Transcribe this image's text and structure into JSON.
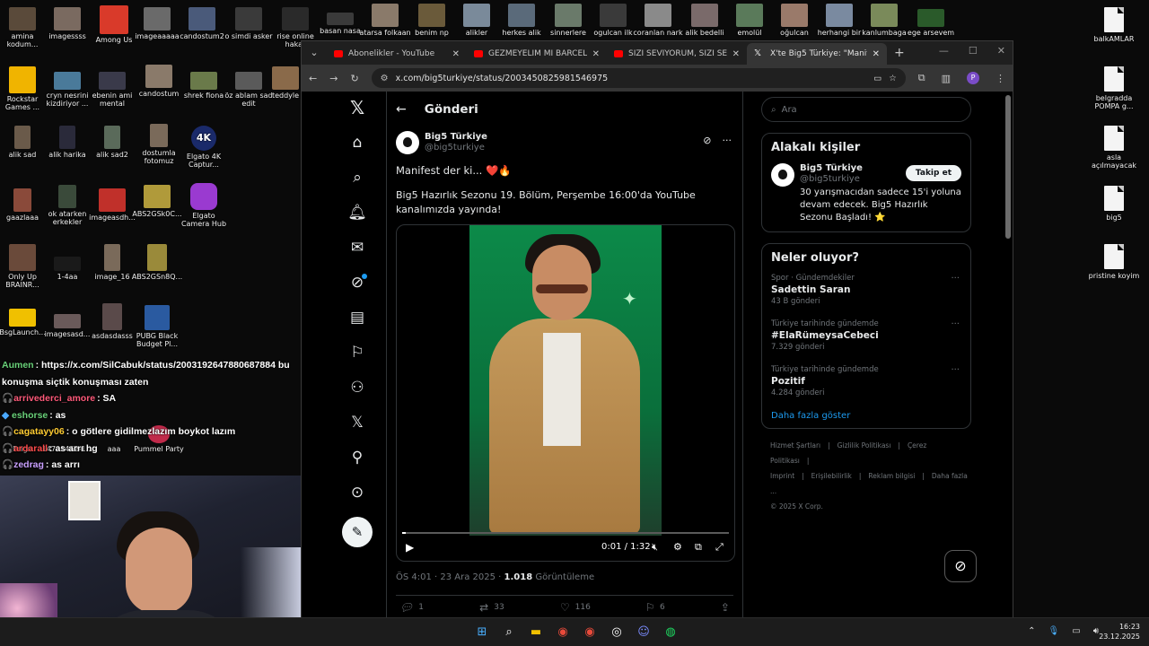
{
  "desktop": {
    "icons": [
      {
        "label": "amina kodum...",
        "color": "#5a4a3a"
      },
      {
        "label": "imagessss",
        "color": "#7a6a60"
      },
      {
        "label": "Among Us",
        "color": "#d93a2a"
      },
      {
        "label": "imageaaaaa",
        "color": "#6a6a6a"
      },
      {
        "label": "candostum2",
        "color": "#4a5a7a"
      },
      {
        "label": "o simdi asker",
        "color": "#3a3a3a"
      },
      {
        "label": "rise online hakar",
        "color": "#2a2a2a"
      },
      {
        "label": "basan nasa",
        "color": "#3a3a3a"
      },
      {
        "label": "atarsa folkaan",
        "color": "#8a7a6a"
      },
      {
        "label": "benim np",
        "color": "#6a5a3a"
      },
      {
        "label": "alikler",
        "color": "#7a8a9a"
      },
      {
        "label": "herkes alik",
        "color": "#5a6a7a"
      },
      {
        "label": "sinnerlere",
        "color": "#6a7a6a"
      },
      {
        "label": "ogulcan ilk",
        "color": "#3a3a3a"
      },
      {
        "label": "coranlan nark",
        "color": "#8a8a8a"
      },
      {
        "label": "alik bedelli",
        "color": "#7a6a6a"
      },
      {
        "label": "emolül",
        "color": "#5a7a5a"
      },
      {
        "label": "oğulcan",
        "color": "#9a7a6a"
      },
      {
        "label": "herhangi bir",
        "color": "#7a8aa0"
      },
      {
        "label": "kanlumbaga",
        "color": "#7a8a5a"
      },
      {
        "label": "ege arsevem",
        "color": "#2a5a2a"
      },
      {
        "label": "Rockstar Games ...",
        "color": "#f0b400"
      },
      {
        "label": "cryn nesrini kizdiriyor ...",
        "color": "#4a7a9a"
      },
      {
        "label": "ebenin ami mental",
        "color": "#3a3a4a"
      },
      {
        "label": "candostum",
        "color": "#8a7a6a"
      },
      {
        "label": "shrek fiona",
        "color": "#6a7a4a"
      },
      {
        "label": "öz ablam sad edit",
        "color": "#5a5a5a"
      },
      {
        "label": "teddyle",
        "color": "#8a6a4a"
      },
      {
        "label": "alik sad",
        "color": "#6a5a4a"
      },
      {
        "label": "alik harika",
        "color": "#2a2a3a"
      },
      {
        "label": "alik sad2",
        "color": "#5a6a5a"
      },
      {
        "label": "dostumla fotomuz",
        "color": "#7a6a5a"
      },
      {
        "label": "Elgato 4K Captur...",
        "color": "#1a2a6a"
      },
      {
        "label": "gaazlaaa",
        "color": "#8a4a3a"
      },
      {
        "label": "ok atarken erkekler",
        "color": "#3a4a3a"
      },
      {
        "label": "imageasdh...",
        "color": "#c0302a"
      },
      {
        "label": "ABS2GSk0C...",
        "color": "#b09a3a"
      },
      {
        "label": "Elgato Camera Hub",
        "color": "#9a3ad0"
      },
      {
        "label": "Only Up BRAINR...",
        "color": "#6a4a3a"
      },
      {
        "label": "1-4aa",
        "color": "#1a1a1a"
      },
      {
        "label": "image_16",
        "color": "#7a6a5a"
      },
      {
        "label": "ABS2GSn8Q...",
        "color": "#9a8a3a"
      },
      {
        "label": "BsgLaunch...",
        "color": "#f0c000"
      },
      {
        "label": "imagesasd...",
        "color": "#6a5a5a"
      },
      {
        "label": "asdasdasss",
        "color": "#5a4a4a"
      },
      {
        "label": "PUBG Black Budget Pl...",
        "color": "#2a5aa0"
      },
      {
        "label": "balkAMLAR",
        "color": "#f4f4f4"
      },
      {
        "label": "belgradda POMPA g...",
        "color": "#f4f4f4"
      },
      {
        "label": "asla açılmayacak",
        "color": "#f4f4f4"
      },
      {
        "label": "big5",
        "color": "#f4f4f4"
      },
      {
        "label": "pristine koyim",
        "color": "#f4f4f4"
      },
      {
        "label": "Feign",
        "color": "#5a5a6a"
      },
      {
        "label": "14701462-1...",
        "color": "#4a4a4a"
      },
      {
        "label": "aaa",
        "color": "#4a4a4a"
      },
      {
        "label": "Pummel Party",
        "color": "#c02a4a"
      }
    ]
  },
  "chat": [
    {
      "user": "Aumen",
      "color": "#6ad27a",
      "msg": ": https://x.com/SilCabuk/status/2003192647880687884 bu konuşma siçtik konuşması zaten"
    },
    {
      "user": "arrivederci_amore",
      "color": "#ff5a7a",
      "msg": ": SA"
    },
    {
      "user": "eshorse",
      "color": "#6ad27a",
      "msg": ": as"
    },
    {
      "user": "cagatayy06",
      "color": "#ffcc33",
      "msg": ": o götlere gidilmezlazım boykot lazım"
    },
    {
      "user": "ardarall",
      "color": "#ff4a4a",
      "msg": ": as arrı hg"
    },
    {
      "user": "zedrag",
      "color": "#c9a0ff",
      "msg": ": as arrı"
    }
  ],
  "browser": {
    "tabs": [
      {
        "title": "Abonelikler - YouTube",
        "icon": "youtube-icon",
        "active": false
      },
      {
        "title": "GEZMEYELİM Mİ BARCELONA",
        "icon": "youtube-icon",
        "active": false
      },
      {
        "title": "SİZİ SEVİYORUM, SİZİ SEVİYOR",
        "icon": "youtube-icon",
        "active": false
      },
      {
        "title": "X'te Big5 Türkiye: \"Manifest de",
        "icon": "x-icon",
        "active": true
      }
    ],
    "url": "x.com/big5turkiye/status/2003450825981546975",
    "profile_initial": "P"
  },
  "x": {
    "header_title": "Gönderi",
    "post": {
      "author": "Big5 Türkiye",
      "handle": "@big5turkiye",
      "text1": "Manifest der ki... ❤️🔥",
      "text2": "Big5 Hazırlık Sezonu 19. Bölüm, Perşembe 16:00'da YouTube kanalımızda yayında!",
      "video_time": "0:01 / 1:32",
      "video_progress": 0.01,
      "time": "ÖS 4:01 · 23 Ara 2025 · ",
      "views_count": "1.018",
      "views_label": " Görüntüleme",
      "replies": "1",
      "reposts": "33",
      "likes": "116",
      "bookmarks": "6"
    },
    "search_placeholder": "Ara",
    "related": {
      "title": "Alakalı kişiler",
      "name": "Big5 Türkiye",
      "handle": "@big5turkiye",
      "follow_label": "Takip et",
      "bio": "30 yarışmacıdan sadece 15'i yoluna devam edecek. Big5 Hazırlık Sezonu Başladı! ⭐"
    },
    "trends": {
      "title": "Neler oluyor?",
      "items": [
        {
          "context": "Spor · Gündemdekiler",
          "name": "Sadettin Saran",
          "count": "43 B gönderi"
        },
        {
          "context": "Türkiye tarihinde gündemde",
          "name": "#ElaRümeysaCebeci",
          "count": "7.329 gönderi"
        },
        {
          "context": "Türkiye tarihinde gündemde",
          "name": "Pozitif",
          "count": "4.284 gönderi"
        }
      ],
      "show_more": "Daha fazla göster"
    },
    "footer": [
      "Hizmet Şartları",
      "|",
      "Gizlilik Politikası",
      "|",
      "Çerez Politikası",
      "|",
      "Imprint",
      "|",
      "Erişilebilirlik",
      "|",
      "Reklam bilgisi",
      "|",
      "Daha fazla ...",
      "© 2025 X Corp."
    ]
  },
  "taskbar": {
    "time": "16:23",
    "date": "23.12.2025"
  }
}
